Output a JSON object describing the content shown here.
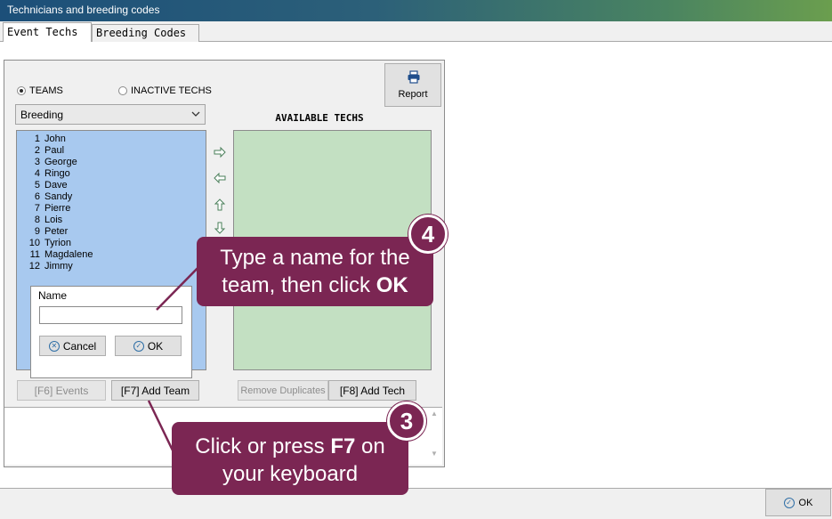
{
  "window": {
    "title": "Technicians and breeding codes"
  },
  "tabs": [
    {
      "label": "Event Techs",
      "active": true
    },
    {
      "label": "Breeding Codes",
      "active": false
    }
  ],
  "radios": {
    "teams": "TEAMS",
    "inactive": "INACTIVE TECHS",
    "selected": "TEAMS"
  },
  "dropdown": {
    "value": "Breeding"
  },
  "teams": [
    {
      "num": "1",
      "name": "John"
    },
    {
      "num": "2",
      "name": "Paul"
    },
    {
      "num": "3",
      "name": "George"
    },
    {
      "num": "4",
      "name": "Ringo"
    },
    {
      "num": "5",
      "name": "Dave"
    },
    {
      "num": "6",
      "name": "Sandy"
    },
    {
      "num": "7",
      "name": "Pierre"
    },
    {
      "num": "8",
      "name": "Lois"
    },
    {
      "num": "9",
      "name": "Peter"
    },
    {
      "num": "10",
      "name": "Tyrion"
    },
    {
      "num": "11",
      "name": "Magdalene"
    },
    {
      "num": "12",
      "name": "Jimmy"
    }
  ],
  "available_techs": {
    "title": "AVAILABLE TECHS"
  },
  "report": {
    "label": "Report"
  },
  "buttons": {
    "events": "[F6] Events",
    "add_team": "[F7] Add Team",
    "remove_duplicates": "Remove Duplicates",
    "add_tech": "[F8] Add Tech",
    "ok": "OK"
  },
  "name_popup": {
    "label": "Name",
    "value": "",
    "cancel": "Cancel",
    "ok": "OK"
  },
  "callouts": {
    "step4": {
      "number": "4",
      "line1": "Type a name for the",
      "line2_pre": "team, then click ",
      "line2_bold": "OK"
    },
    "step3": {
      "number": "3",
      "line1_pre": "Click or press ",
      "line1_bold": "F7",
      "line1_post": " on",
      "line2": "your keyboard"
    }
  },
  "colors": {
    "callout": "#7b2653",
    "teams_list": "#a8c9ef",
    "techs_list": "#c3e0c2"
  }
}
